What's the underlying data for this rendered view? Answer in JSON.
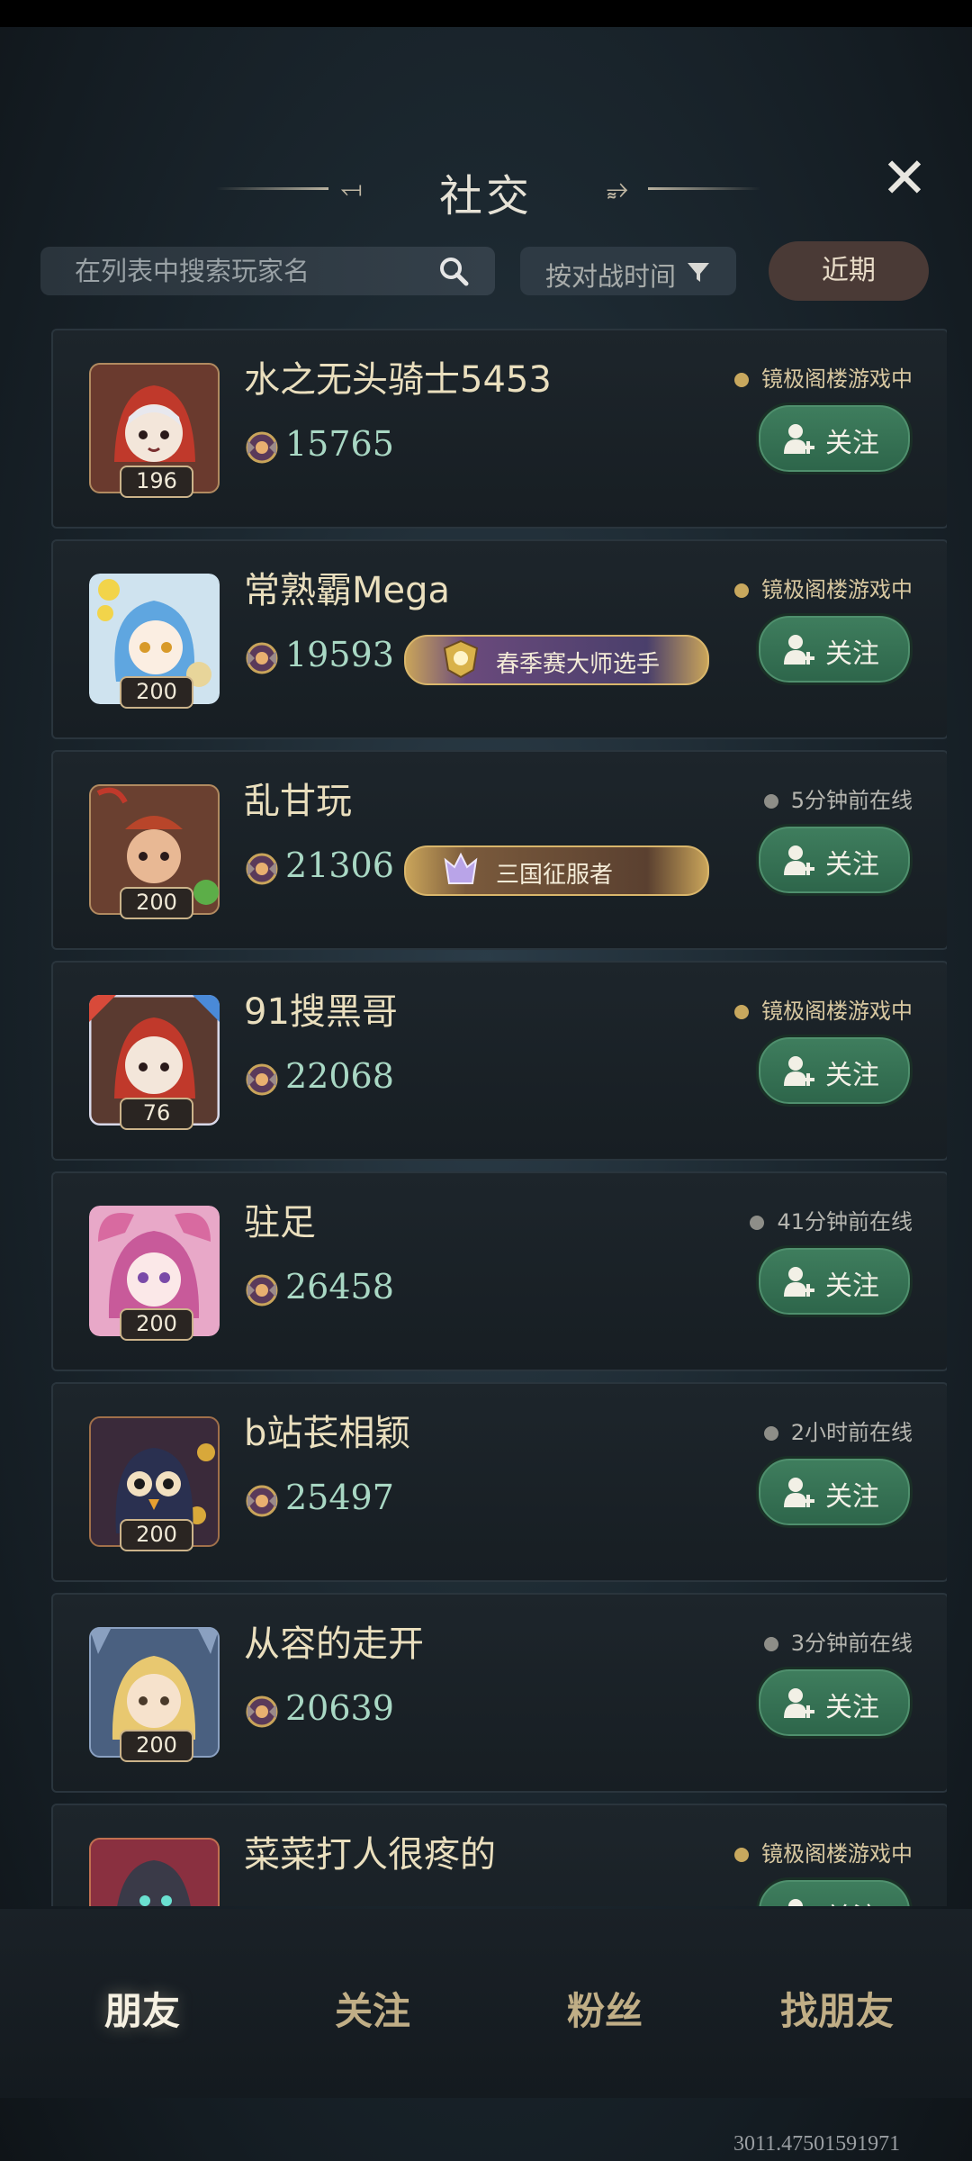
{
  "header": {
    "title": "社交",
    "close_icon": "close-icon"
  },
  "controls": {
    "search_placeholder": "在列表中搜索玩家名",
    "sort_label": "按对战时间",
    "recent_label": "近期"
  },
  "colors": {
    "follow_green": "#3f7e5e",
    "status_gold": "#c8a85e",
    "score_teal": "#a9d8c4"
  },
  "players": [
    {
      "name": "水之无头骑士5453",
      "level": "196",
      "score": "15765",
      "badge": "",
      "status": "镜极阁楼游戏中",
      "online": true,
      "follow_label": "关注"
    },
    {
      "name": "常熟霸Mega",
      "level": "200",
      "score": "19593",
      "badge": "春季赛大师选手",
      "status": "镜极阁楼游戏中",
      "online": true,
      "follow_label": "关注"
    },
    {
      "name": "乱甘玩",
      "level": "200",
      "score": "21306",
      "badge": "三国征服者",
      "status": "5分钟前在线",
      "online": false,
      "follow_label": "关注"
    },
    {
      "name": "91搜黑哥",
      "level": "76",
      "score": "22068",
      "badge": "",
      "status": "镜极阁楼游戏中",
      "online": true,
      "follow_label": "关注"
    },
    {
      "name": "驻足",
      "level": "200",
      "score": "26458",
      "badge": "",
      "status": "41分钟前在线",
      "online": false,
      "follow_label": "关注"
    },
    {
      "name": "b站苌相颖",
      "level": "200",
      "score": "25497",
      "badge": "",
      "status": "2小时前在线",
      "online": false,
      "follow_label": "关注"
    },
    {
      "name": "从容的走开",
      "level": "200",
      "score": "20639",
      "badge": "",
      "status": "3分钟前在线",
      "online": false,
      "follow_label": "关注"
    },
    {
      "name": "菜菜打人很疼的",
      "level": "",
      "score": "",
      "badge": "",
      "status": "镜极阁楼游戏中",
      "online": true,
      "follow_label": "关注"
    }
  ],
  "nav": {
    "friends": "朋友",
    "following": "关注",
    "fans": "粉丝",
    "find": "找朋友"
  },
  "coordinates_text": "3011.47501591971"
}
